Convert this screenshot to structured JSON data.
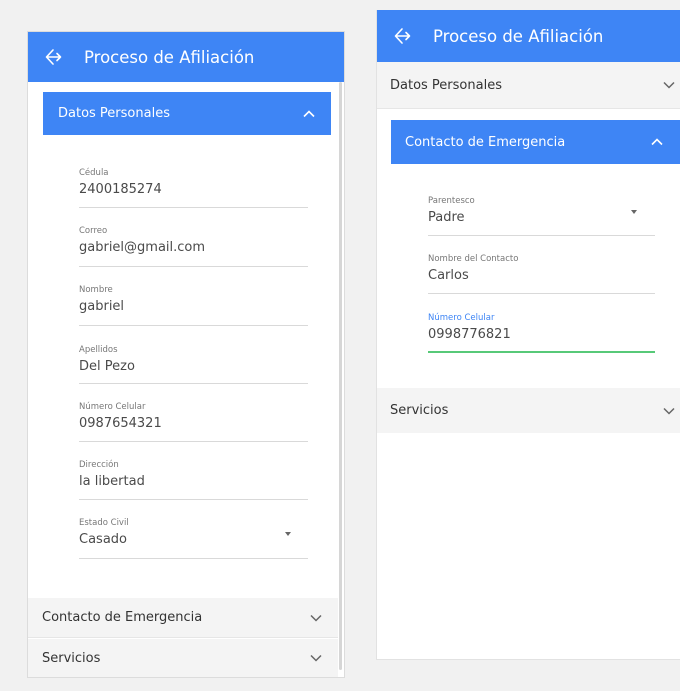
{
  "app": {
    "title": "Proceso de Afiliación"
  },
  "left": {
    "sections": {
      "personal": "Datos Personales",
      "emergency": "Contacto de Emergencia",
      "services": "Servicios"
    },
    "fields": [
      {
        "label": "Cédula",
        "value": "2400185274"
      },
      {
        "label": "Correo",
        "value": "gabriel@gmail.com"
      },
      {
        "label": "Nombre",
        "value": "gabriel"
      },
      {
        "label": "Apellidos",
        "value": "Del Pezo"
      },
      {
        "label": "Número Celular",
        "value": "0987654321"
      },
      {
        "label": "Dirección",
        "value": "la libertad"
      },
      {
        "label": "Estado Civil",
        "value": "Casado"
      }
    ]
  },
  "right": {
    "sections": {
      "personal": "Datos Personales",
      "emergency": "Contacto de Emergencia",
      "services": "Servicios"
    },
    "fields": [
      {
        "label": "Parentesco",
        "value": "Padre"
      },
      {
        "label": "Nombre del Contacto",
        "value": "Carlos"
      },
      {
        "label": "Número Celular",
        "value": "0998776821"
      }
    ]
  },
  "colors": {
    "primary": "#3e85f5",
    "focus_underline": "#57c978",
    "collapsed_header": "#f4f4f4"
  }
}
